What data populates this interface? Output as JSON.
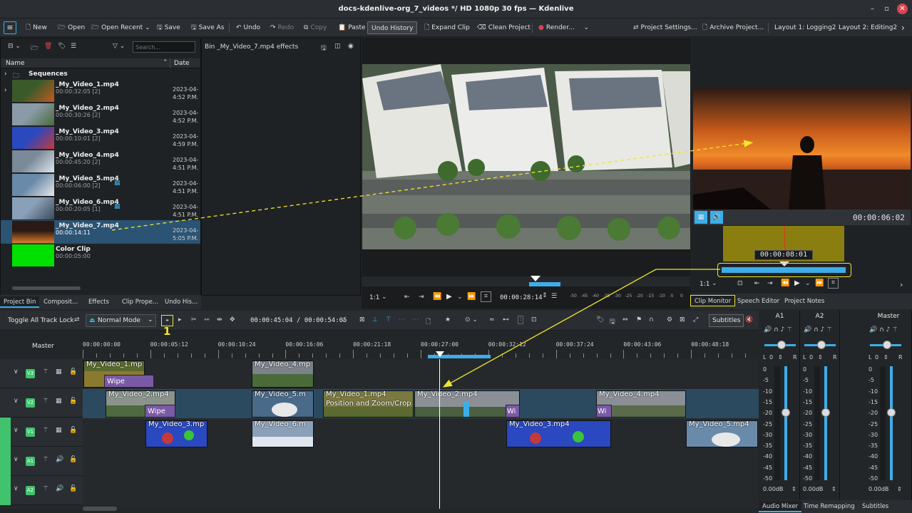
{
  "window": {
    "title": "docs-kdenlive-org_7_videos */ HD 1080p 30 fps — Kdenlive",
    "minimize": "–",
    "maximize": "▫",
    "close": "✕"
  },
  "toolbar": {
    "new": "New",
    "open": "Open",
    "open_recent": "Open Recent",
    "save": "Save",
    "save_as": "Save As",
    "undo": "Undo",
    "redo": "Redo",
    "copy": "Copy",
    "paste": "Paste",
    "undo_history": "Undo History",
    "expand_clip": "Expand Clip",
    "clean_project": "Clean Project",
    "render": "Render...",
    "project_settings": "Project Settings...",
    "archive_project": "Archive Project...",
    "layout1": "Layout 1: Logging2",
    "layout2": "Layout 2: Editing2",
    "more": "›"
  },
  "bin": {
    "search_placeholder": "Search...",
    "col_name": "Name",
    "col_date": "Date",
    "folder": "Sequences",
    "clips": [
      {
        "name": "_My_Video_1.mp4",
        "dur": "00:00:32:05 [2]",
        "date": "2023-04-",
        "time": "4:52 P.M."
      },
      {
        "name": "_My_Video_2.mp4",
        "dur": "00:00:30:26 [2]",
        "date": "2023-04-",
        "time": "4:52 P.M."
      },
      {
        "name": "_My_Video_3.mp4",
        "dur": "00:00:10:01 [2]",
        "date": "2023-04-",
        "time": "4:59 P.M."
      },
      {
        "name": "_My_Video_4.mp4",
        "dur": "00:00:45:20 [2]",
        "date": "2023-04-",
        "time": "4:51 P.M."
      },
      {
        "name": "_My_Video_5.mp4",
        "dur": "00:00:06:00 [2]",
        "date": "2023-04-",
        "time": "4:51 P.M."
      },
      {
        "name": "_My_Video_6.mp4",
        "dur": "00:00:20:05 [1]",
        "date": "2023-04-",
        "time": "4:51 P.M."
      },
      {
        "name": "_My_Video_7.mp4",
        "dur": "00:00:14:11",
        "date": "2023-04-",
        "time": "5:05 P.M."
      },
      {
        "name": "Color Clip",
        "dur": "00:00:05:00",
        "date": "",
        "time": ""
      }
    ]
  },
  "effects_panel": {
    "title": "Bin _My_Video_7.mp4 effects"
  },
  "left_tabs": [
    "Project Bin",
    "Composit...",
    "Effects",
    "Clip Prope...",
    "Undo His..."
  ],
  "project_monitor": {
    "zoom": "1:1",
    "timecode": "00:00:28:14",
    "vu": [
      "-50",
      "-45",
      "-40",
      "-35",
      "-30",
      "-25",
      "-20",
      "-15",
      "-10",
      "-5",
      "0"
    ]
  },
  "clip_monitor": {
    "timecode": "00:00:06:02",
    "zone_time": "00:00:08:01",
    "zoom": "1:1"
  },
  "right_tabs": [
    "Clip Monitor",
    "Speech Editor",
    "Project Notes"
  ],
  "timeline_toolbar": {
    "toggle_lock": "Toggle All Track Lock",
    "mode": "Normal Mode",
    "position": "00:00:45:04 / 00:00:54:05",
    "subtitles": "Subtitles",
    "annotation": "1"
  },
  "ruler": {
    "master": "Master",
    "labels": [
      "00:00:00:00",
      "00:00:05:12",
      "00:00:10:24",
      "00:00:16:06",
      "00:00:21:18",
      "00:00:27:00",
      "00:00:32:12",
      "00:00:37:24",
      "00:00:43:06",
      "00:00:48:18"
    ]
  },
  "tracks": [
    {
      "id": "V3"
    },
    {
      "id": "V2"
    },
    {
      "id": "V1"
    },
    {
      "id": "A1"
    },
    {
      "id": "A2"
    }
  ],
  "timeline_clips": {
    "v3": [
      {
        "label": "My_Video_1.mp"
      },
      {
        "label": "My_Video_4.mp"
      }
    ],
    "v3_wipe": "Wipe",
    "v2": [
      {
        "label": "My_Video_2.mp4"
      },
      {
        "label": "My_Video_5.m"
      },
      {
        "label": "My_Video_1.mp4"
      },
      {
        "label": "My_Video_2.mp4"
      },
      {
        "label": "My_Video_4.mp4"
      }
    ],
    "v2_sub": "Position and Zoom/Crop",
    "v2_wipe": "Wipe",
    "v2_wi": "Wi",
    "v2_wi2": "Wi",
    "v1": [
      {
        "label": "My_Video_3.mp"
      },
      {
        "label": "My_Video_6.m"
      },
      {
        "label": "My_Video_3.mp4"
      },
      {
        "label": "My_Video_5.mp4"
      }
    ]
  },
  "mixer": {
    "a1": "A1",
    "a2": "A2",
    "master": "Master",
    "L": "L",
    "R": "R",
    "zero": "0",
    "scale": [
      "0",
      "-5",
      "-10",
      "-15",
      "-20",
      "-25",
      "-30",
      "-35",
      "-40",
      "-45",
      "-50"
    ],
    "db": "0.00dB"
  },
  "bottom_tabs": [
    "Audio Mixer",
    "Time Remapping",
    "Subtitles"
  ],
  "colors": {
    "accent": "#3daee9",
    "annotation": "#f0e62a",
    "selection": "#2b5373",
    "panel": "#1f2225"
  }
}
